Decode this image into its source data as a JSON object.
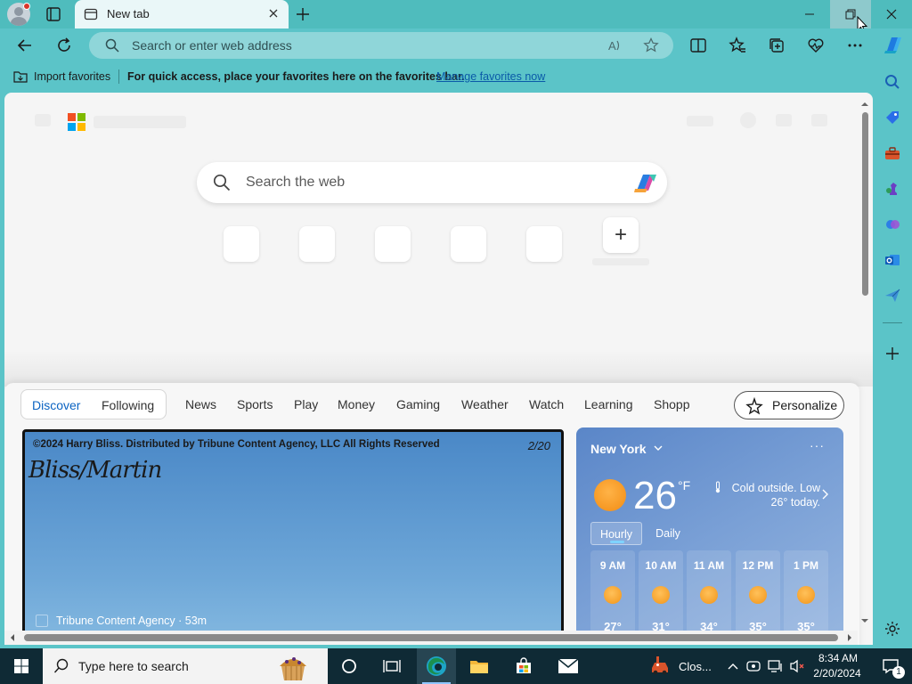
{
  "window": {
    "tab_title": "New tab"
  },
  "toolbar": {
    "address_placeholder": "Search or enter web address"
  },
  "favorites_bar": {
    "import_label": "Import favorites",
    "message": "For quick access, place your favorites here on the favorites bar.",
    "manage_link": "Manage favorites now"
  },
  "newtab": {
    "search_placeholder": "Search the web",
    "add_shortcut_symbol": "+"
  },
  "feed": {
    "discover": "Discover",
    "following": "Following",
    "categories": [
      "News",
      "Sports",
      "Play",
      "Money",
      "Gaming",
      "Weather",
      "Watch",
      "Learning",
      "Shopp"
    ],
    "personalize": "Personalize",
    "comic": {
      "copyright": "©2024 Harry Bliss. Distributed by Tribune Content Agency, LLC All Rights Reserved",
      "date": "2/20",
      "signature": "Bliss/Martin",
      "source": "Tribune Content Agency · 53m"
    }
  },
  "weather": {
    "city": "New York",
    "more": "···",
    "temperature": "26",
    "unit": "°F",
    "condition_line1": "Cold outside. Low",
    "condition_line2": "26° today.",
    "tabs": [
      "Hourly",
      "Daily"
    ],
    "active_tab": "Hourly",
    "hours": [
      {
        "time": "9 AM",
        "temp": "27°"
      },
      {
        "time": "10 AM",
        "temp": "31°"
      },
      {
        "time": "11 AM",
        "temp": "34°"
      },
      {
        "time": "12 PM",
        "temp": "35°"
      },
      {
        "time": "1 PM",
        "temp": "35°"
      }
    ]
  },
  "taskbar": {
    "search_placeholder": "Type here to search",
    "weather_app_label": "Clos...",
    "time": "8:34 AM",
    "date": "2/20/2024",
    "notification_count": "1"
  },
  "colors": {
    "chrome": "#5bc4c8",
    "accent": "#0b63c2",
    "taskbar": "#0f2a35",
    "weather_card": "#6f97d2"
  }
}
